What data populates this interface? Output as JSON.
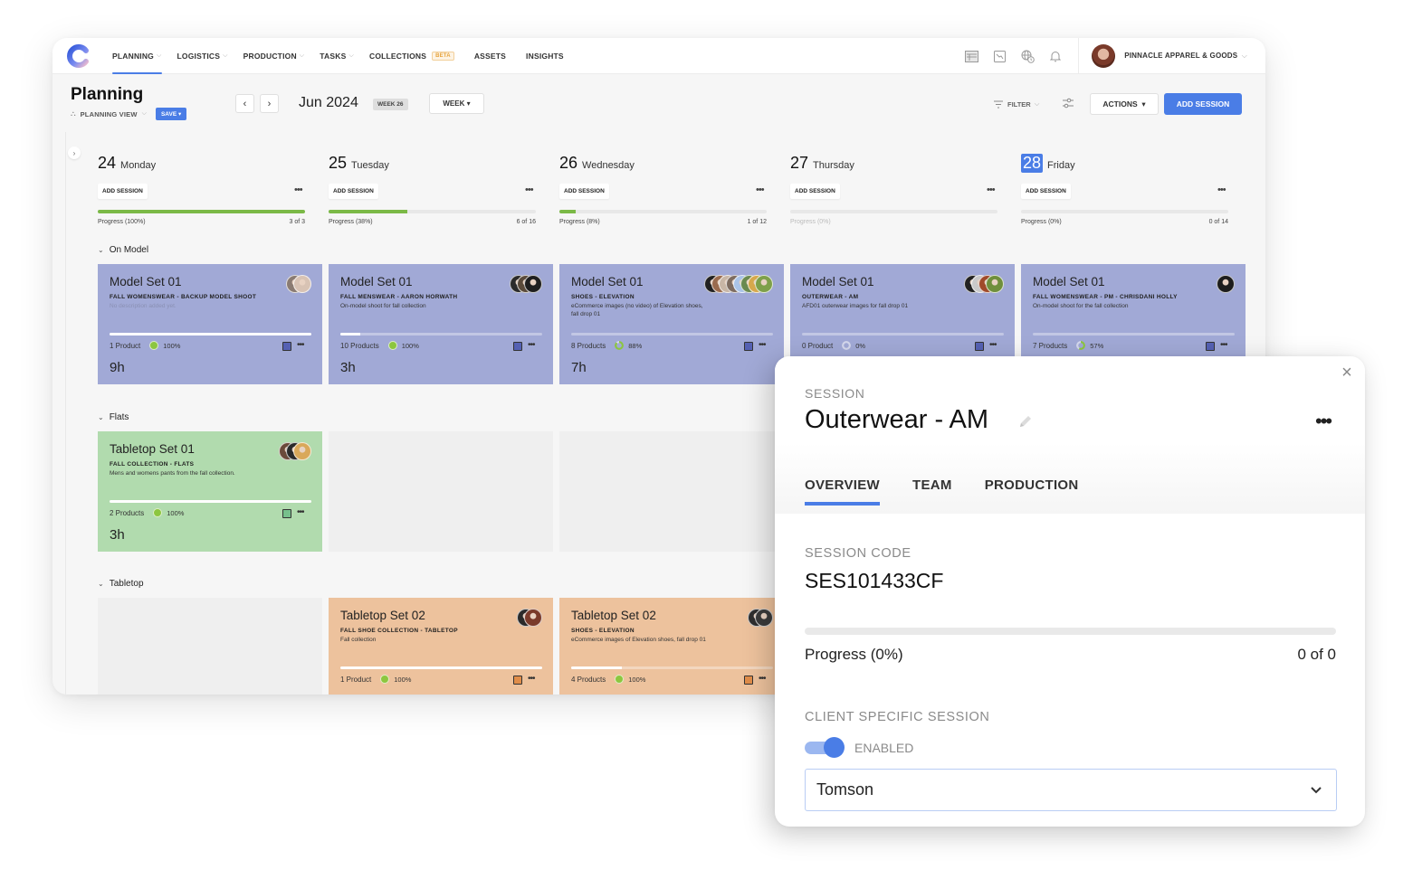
{
  "nav": {
    "logo": "c-logo-icon",
    "items": [
      {
        "label": "PLANNING",
        "caret": true,
        "active": true
      },
      {
        "label": "LOGISTICS",
        "caret": true
      },
      {
        "label": "PRODUCTION",
        "caret": true
      },
      {
        "label": "TASKS",
        "caret": true
      },
      {
        "label": "COLLECTIONS",
        "badge": "BETA"
      },
      {
        "label": "ASSETS"
      },
      {
        "label": "INSIGHTS"
      }
    ],
    "icons": [
      "calendar-board-icon",
      "chart-icon",
      "globe-clock-icon",
      "bell-icon"
    ],
    "org_name": "PINNACLE APPAREL & GOODS"
  },
  "header": {
    "title": "Planning",
    "view_label": "PLANNING VIEW",
    "save_label": "SAVE",
    "prev": "‹",
    "next": "›",
    "month": "Jun 2024",
    "week_badge": "WEEK 26",
    "range_select": "WEEK",
    "filter_label": "FILTER",
    "actions_label": "ACTIONS",
    "add_session_label": "ADD SESSION"
  },
  "days": [
    {
      "num": "24",
      "name": "Monday",
      "add": "ADD SESSION",
      "progress_pct": 100,
      "progress_label": "Progress (100%)",
      "count": "3 of 3"
    },
    {
      "num": "25",
      "name": "Tuesday",
      "add": "ADD SESSION",
      "progress_pct": 38,
      "progress_label": "Progress (38%)",
      "count": "6 of 16"
    },
    {
      "num": "26",
      "name": "Wednesday",
      "add": "ADD SESSION",
      "progress_pct": 8,
      "progress_label": "Progress (8%)",
      "count": "1 of 12"
    },
    {
      "num": "27",
      "name": "Thursday",
      "add": "ADD SESSION",
      "progress_pct": 0,
      "progress_label": "Progress (0%)",
      "count": ""
    },
    {
      "num": "28",
      "name": "Friday",
      "add": "ADD SESSION",
      "progress_pct": 0,
      "progress_label": "Progress (0%)",
      "count": "0 of 14",
      "today": true
    }
  ],
  "groups": [
    {
      "label": "On Model"
    },
    {
      "label": "Flats"
    },
    {
      "label": "Tabletop"
    }
  ],
  "cards": {
    "on_model": [
      {
        "title": "Model Set 01",
        "subtitle": "FALL WOMENSWEAR - BACKUP MODEL SHOOT",
        "description": "No description added yet.",
        "products": "1 Product",
        "pct": "100%",
        "status_pct": 100,
        "bar_pct": 100,
        "hours": "9h"
      },
      {
        "title": "Model Set 01",
        "subtitle": "FALL MENSWEAR - AARON HORWATH",
        "description": "On-model shoot for fall collection",
        "products": "10 Products",
        "pct": "100%",
        "status_pct": 100,
        "bar_pct": 10,
        "hours": "3h"
      },
      {
        "title": "Model Set 01",
        "subtitle": "SHOES - ELEVATION",
        "description": "eCommerce images (no video) of Elevation shoes, fall drop 01",
        "products": "8 Products",
        "pct": "88%",
        "status_pct": 88,
        "bar_pct": 0,
        "hours": "7h"
      },
      {
        "title": "Model Set 01",
        "subtitle": "OUTERWEAR - AM",
        "description": "AFD01 outerwear images for fall drop 01",
        "products": "0 Product",
        "pct": "0%",
        "status_pct": 0,
        "bar_pct": 0,
        "hours": ""
      },
      {
        "title": "Model Set 01",
        "subtitle": "FALL WOMENSWEAR - PM - CHRISDANI HOLLY",
        "description": "On-model shoot for the fall collection",
        "products": "7 Products",
        "pct": "57%",
        "status_pct": 57,
        "bar_pct": 0,
        "hours": ""
      }
    ],
    "flats": [
      {
        "title": "Tabletop Set 01",
        "subtitle": "FALL COLLECTION - FLATS",
        "description": "Mens and womens pants from the fall collection.",
        "products": "2 Products",
        "pct": "100%",
        "status_pct": 100,
        "bar_pct": 100,
        "hours": "3h"
      }
    ],
    "tabletop": [
      {
        "title": "Tabletop Set 02",
        "subtitle": "FALL SHOE COLLECTION - TABLETOP",
        "description": "Fall collection",
        "products": "1 Product",
        "pct": "100%",
        "status_pct": 100,
        "bar_pct": 100,
        "hours": ""
      },
      {
        "title": "Tabletop Set 02",
        "subtitle": "SHOES - ELEVATION",
        "description": "eCommerce images of Elevation shoes, fall drop 01",
        "products": "4 Products",
        "pct": "100%",
        "status_pct": 100,
        "bar_pct": 25,
        "hours": ""
      }
    ]
  },
  "panel": {
    "kicker": "SESSION",
    "title": "Outerwear - AM",
    "tabs": [
      "OVERVIEW",
      "TEAM",
      "PRODUCTION"
    ],
    "active_tab": "OVERVIEW",
    "session_code_label": "SESSION CODE",
    "session_code": "SES101433CF",
    "progress_pct": 0,
    "progress_label": "Progress (0%)",
    "progress_count": "0 of 0",
    "client_label": "CLIENT SPECIFIC SESSION",
    "toggle_state": "ENABLED",
    "toggle_on": true,
    "client_value": "Tomson"
  },
  "colors": {
    "accent": "#4a7de6",
    "progress": "#7bb947",
    "card_blue": "#a1a9d6",
    "card_green": "#b1dbae",
    "card_orange": "#edc29d"
  }
}
